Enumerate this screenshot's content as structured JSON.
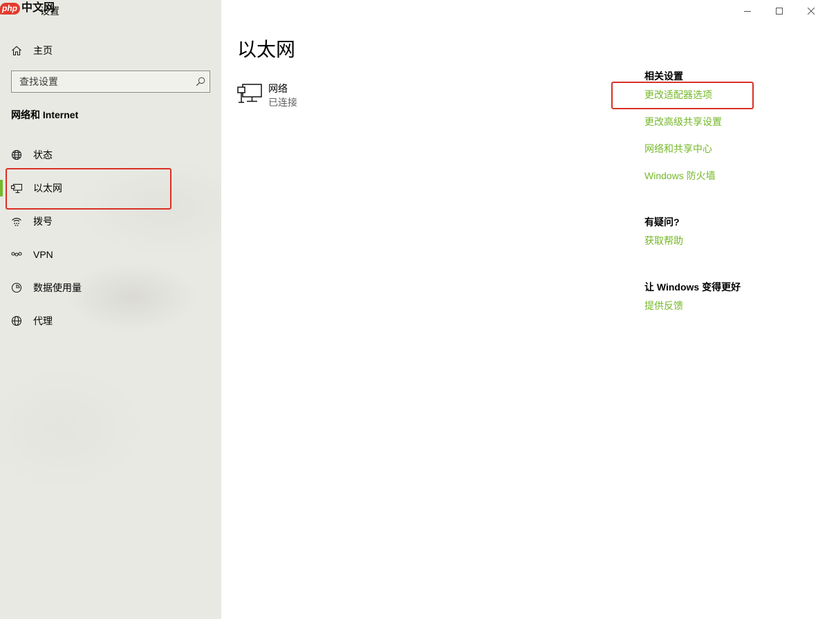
{
  "watermark": {
    "logo": "php",
    "text": "中文网"
  },
  "window": {
    "title": "设置",
    "controls": {
      "minimize_icon": "minimize-icon",
      "maximize_icon": "maximize-icon",
      "close_icon": "close-icon"
    }
  },
  "sidebar": {
    "home": {
      "label": "主页",
      "icon": "home-icon"
    },
    "search": {
      "placeholder": "查找设置",
      "icon": "search-icon"
    },
    "section_title": "网络和 Internet",
    "items": [
      {
        "label": "状态",
        "icon": "status-icon",
        "selected": false
      },
      {
        "label": "以太网",
        "icon": "ethernet-icon",
        "selected": true
      },
      {
        "label": "拨号",
        "icon": "dial-up-icon",
        "selected": false
      },
      {
        "label": "VPN",
        "icon": "vpn-icon",
        "selected": false
      },
      {
        "label": "数据使用量",
        "icon": "data-usage-icon",
        "selected": false
      },
      {
        "label": "代理",
        "icon": "proxy-icon",
        "selected": false
      }
    ]
  },
  "main": {
    "title": "以太网",
    "network": {
      "name": "网络",
      "status": "已连接",
      "icon": "ethernet-network-icon"
    },
    "related": {
      "heading": "相关设置",
      "links": [
        "更改适配器选项",
        "更改高级共享设置",
        "网络和共享中心",
        "Windows 防火墙"
      ]
    },
    "help": {
      "heading": "有疑问?",
      "link": "获取帮助"
    },
    "feedback": {
      "heading": "让 Windows 变得更好",
      "link": "提供反馈"
    }
  },
  "colors": {
    "accent": "#76b82a",
    "link": "#76b82a",
    "annotation": "#d93025",
    "sidebar_bg": "#e9e9e3"
  }
}
